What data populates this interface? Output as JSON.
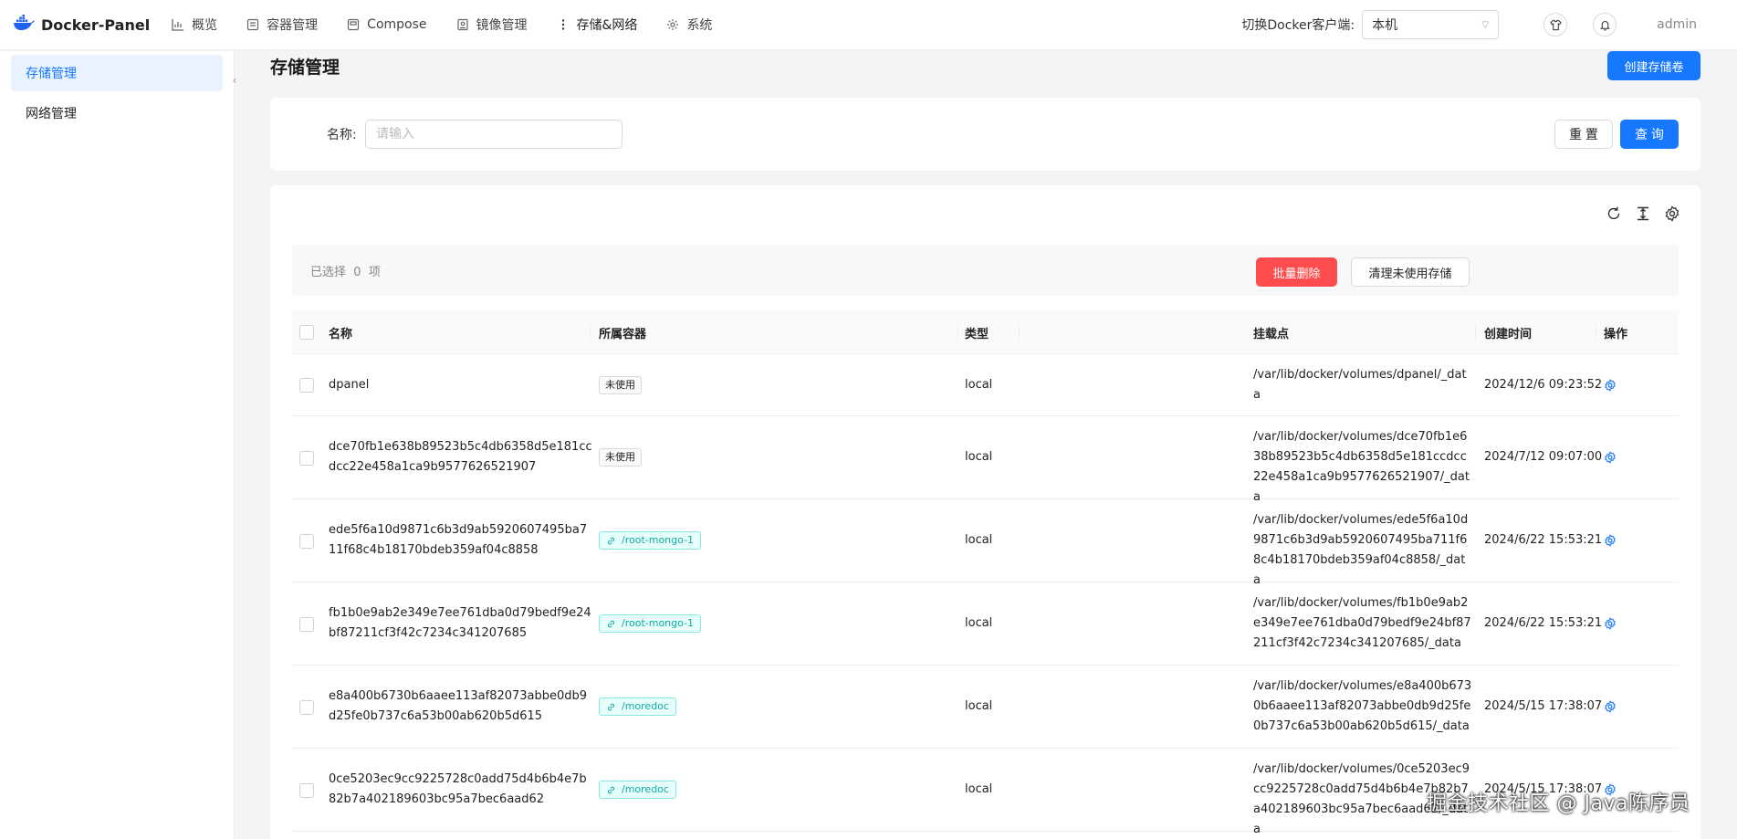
{
  "app": {
    "name": "Docker-Panel",
    "user": "admin"
  },
  "nav": [
    {
      "label": "概览",
      "icon": "chart-icon"
    },
    {
      "label": "容器管理",
      "icon": "container-icon"
    },
    {
      "label": "Compose",
      "icon": "compose-icon"
    },
    {
      "label": "镜像管理",
      "icon": "image-icon"
    },
    {
      "label": "存储&网络",
      "icon": "more-vertical-icon"
    },
    {
      "label": "系统",
      "icon": "gear-icon"
    }
  ],
  "client_switch": {
    "label": "切换Docker客户端:",
    "value": "本机"
  },
  "sidebar": {
    "items": [
      {
        "label": "存储管理"
      },
      {
        "label": "网络管理"
      }
    ]
  },
  "page": {
    "title": "存储管理",
    "create_button": "创建存储卷"
  },
  "search": {
    "label": "名称:",
    "placeholder": "请输入",
    "reset": "重 置",
    "query": "查 询"
  },
  "selection": {
    "prefix": "已选择",
    "count": "0",
    "suffix": "项",
    "batch_delete": "批量删除",
    "clean_unused": "清理未使用存储"
  },
  "table": {
    "columns": {
      "name": "名称",
      "container": "所属容器",
      "type": "类型",
      "mount": "挂载点",
      "created": "创建时间",
      "actions": "操作"
    },
    "rows": [
      {
        "name": "dpanel",
        "tag": "未使用",
        "tag_type": "unused",
        "type": "local",
        "mount": "/var/lib/docker/volumes/dpanel/_data",
        "created": "2024/12/6 09:23:52"
      },
      {
        "name": "dce70fb1e638b89523b5c4db6358d5e181ccdcc22e458a1ca9b9577626521907",
        "tag": "未使用",
        "tag_type": "unused",
        "type": "local",
        "mount": "/var/lib/docker/volumes/dce70fb1e638b89523b5c4db6358d5e181ccdcc22e458a1ca9b9577626521907/_data",
        "created": "2024/7/12 09:07:00"
      },
      {
        "name": "ede5f6a10d9871c6b3d9ab5920607495ba711f68c4b18170bdeb359af04c8858",
        "tag": "/root-mongo-1",
        "tag_type": "link",
        "type": "local",
        "mount": "/var/lib/docker/volumes/ede5f6a10d9871c6b3d9ab5920607495ba711f68c4b18170bdeb359af04c8858/_data",
        "created": "2024/6/22 15:53:21"
      },
      {
        "name": "fb1b0e9ab2e349e7ee761dba0d79bedf9e24bf87211cf3f42c7234c341207685",
        "tag": "/root-mongo-1",
        "tag_type": "link",
        "type": "local",
        "mount": "/var/lib/docker/volumes/fb1b0e9ab2e349e7ee761dba0d79bedf9e24bf87211cf3f42c7234c341207685/_data",
        "created": "2024/6/22 15:53:21"
      },
      {
        "name": "e8a400b6730b6aaee113af82073abbe0db9d25fe0b737c6a53b00ab620b5d615",
        "tag": "/moredoc",
        "tag_type": "link",
        "type": "local",
        "mount": "/var/lib/docker/volumes/e8a400b6730b6aaee113af82073abbe0db9d25fe0b737c6a53b00ab620b5d615/_data",
        "created": "2024/5/15 17:38:07"
      },
      {
        "name": "0ce5203ec9cc9225728c0add75d4b6b4e7b82b7a402189603bc95a7bec6aad62",
        "tag": "/moredoc",
        "tag_type": "link",
        "type": "local",
        "mount": "/var/lib/docker/volumes/0ce5203ec9cc9225728c0add75d4b6b4e7b82b7a402189603bc95a7bec6aad62/_data",
        "created": "2024/5/15 17:38:07"
      }
    ]
  },
  "watermark": "掘金技术社区 @ Java陈序员",
  "colors": {
    "primary": "#1677ff",
    "danger": "#ff4d4f",
    "link_tag": "#13a8a8"
  }
}
